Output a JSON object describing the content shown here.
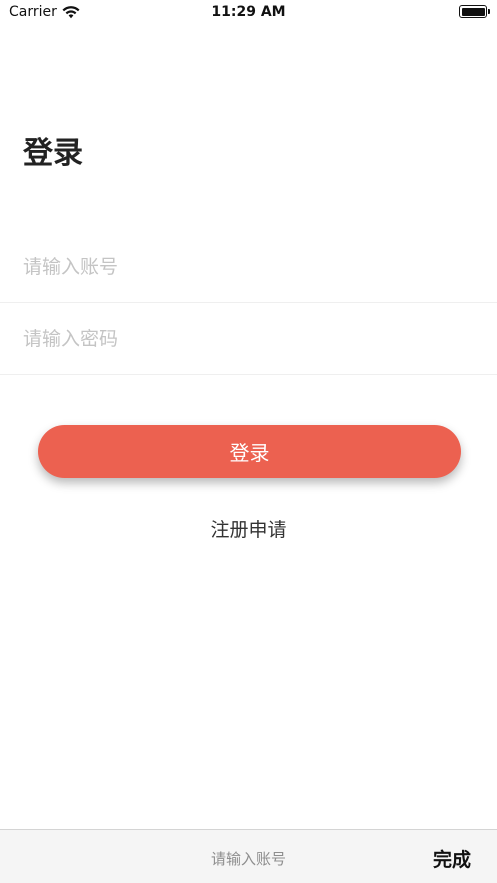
{
  "status_bar": {
    "carrier": "Carrier",
    "time": "11:29 AM",
    "wifi_icon": "wifi-icon",
    "battery_icon": "battery-full-icon",
    "battery_level": 1.0
  },
  "login": {
    "title": "登录",
    "account_placeholder": "请输入账号",
    "account_value": "",
    "password_placeholder": "请输入密码",
    "password_value": "",
    "login_button_label": "登录",
    "register_link_label": "注册申请"
  },
  "keyboard_toolbar": {
    "hint": "请输入账号",
    "done_label": "完成"
  },
  "colors": {
    "accent": "#ec6150",
    "placeholder": "#c4c4c4",
    "toolbar_bg": "#f5f5f5"
  }
}
